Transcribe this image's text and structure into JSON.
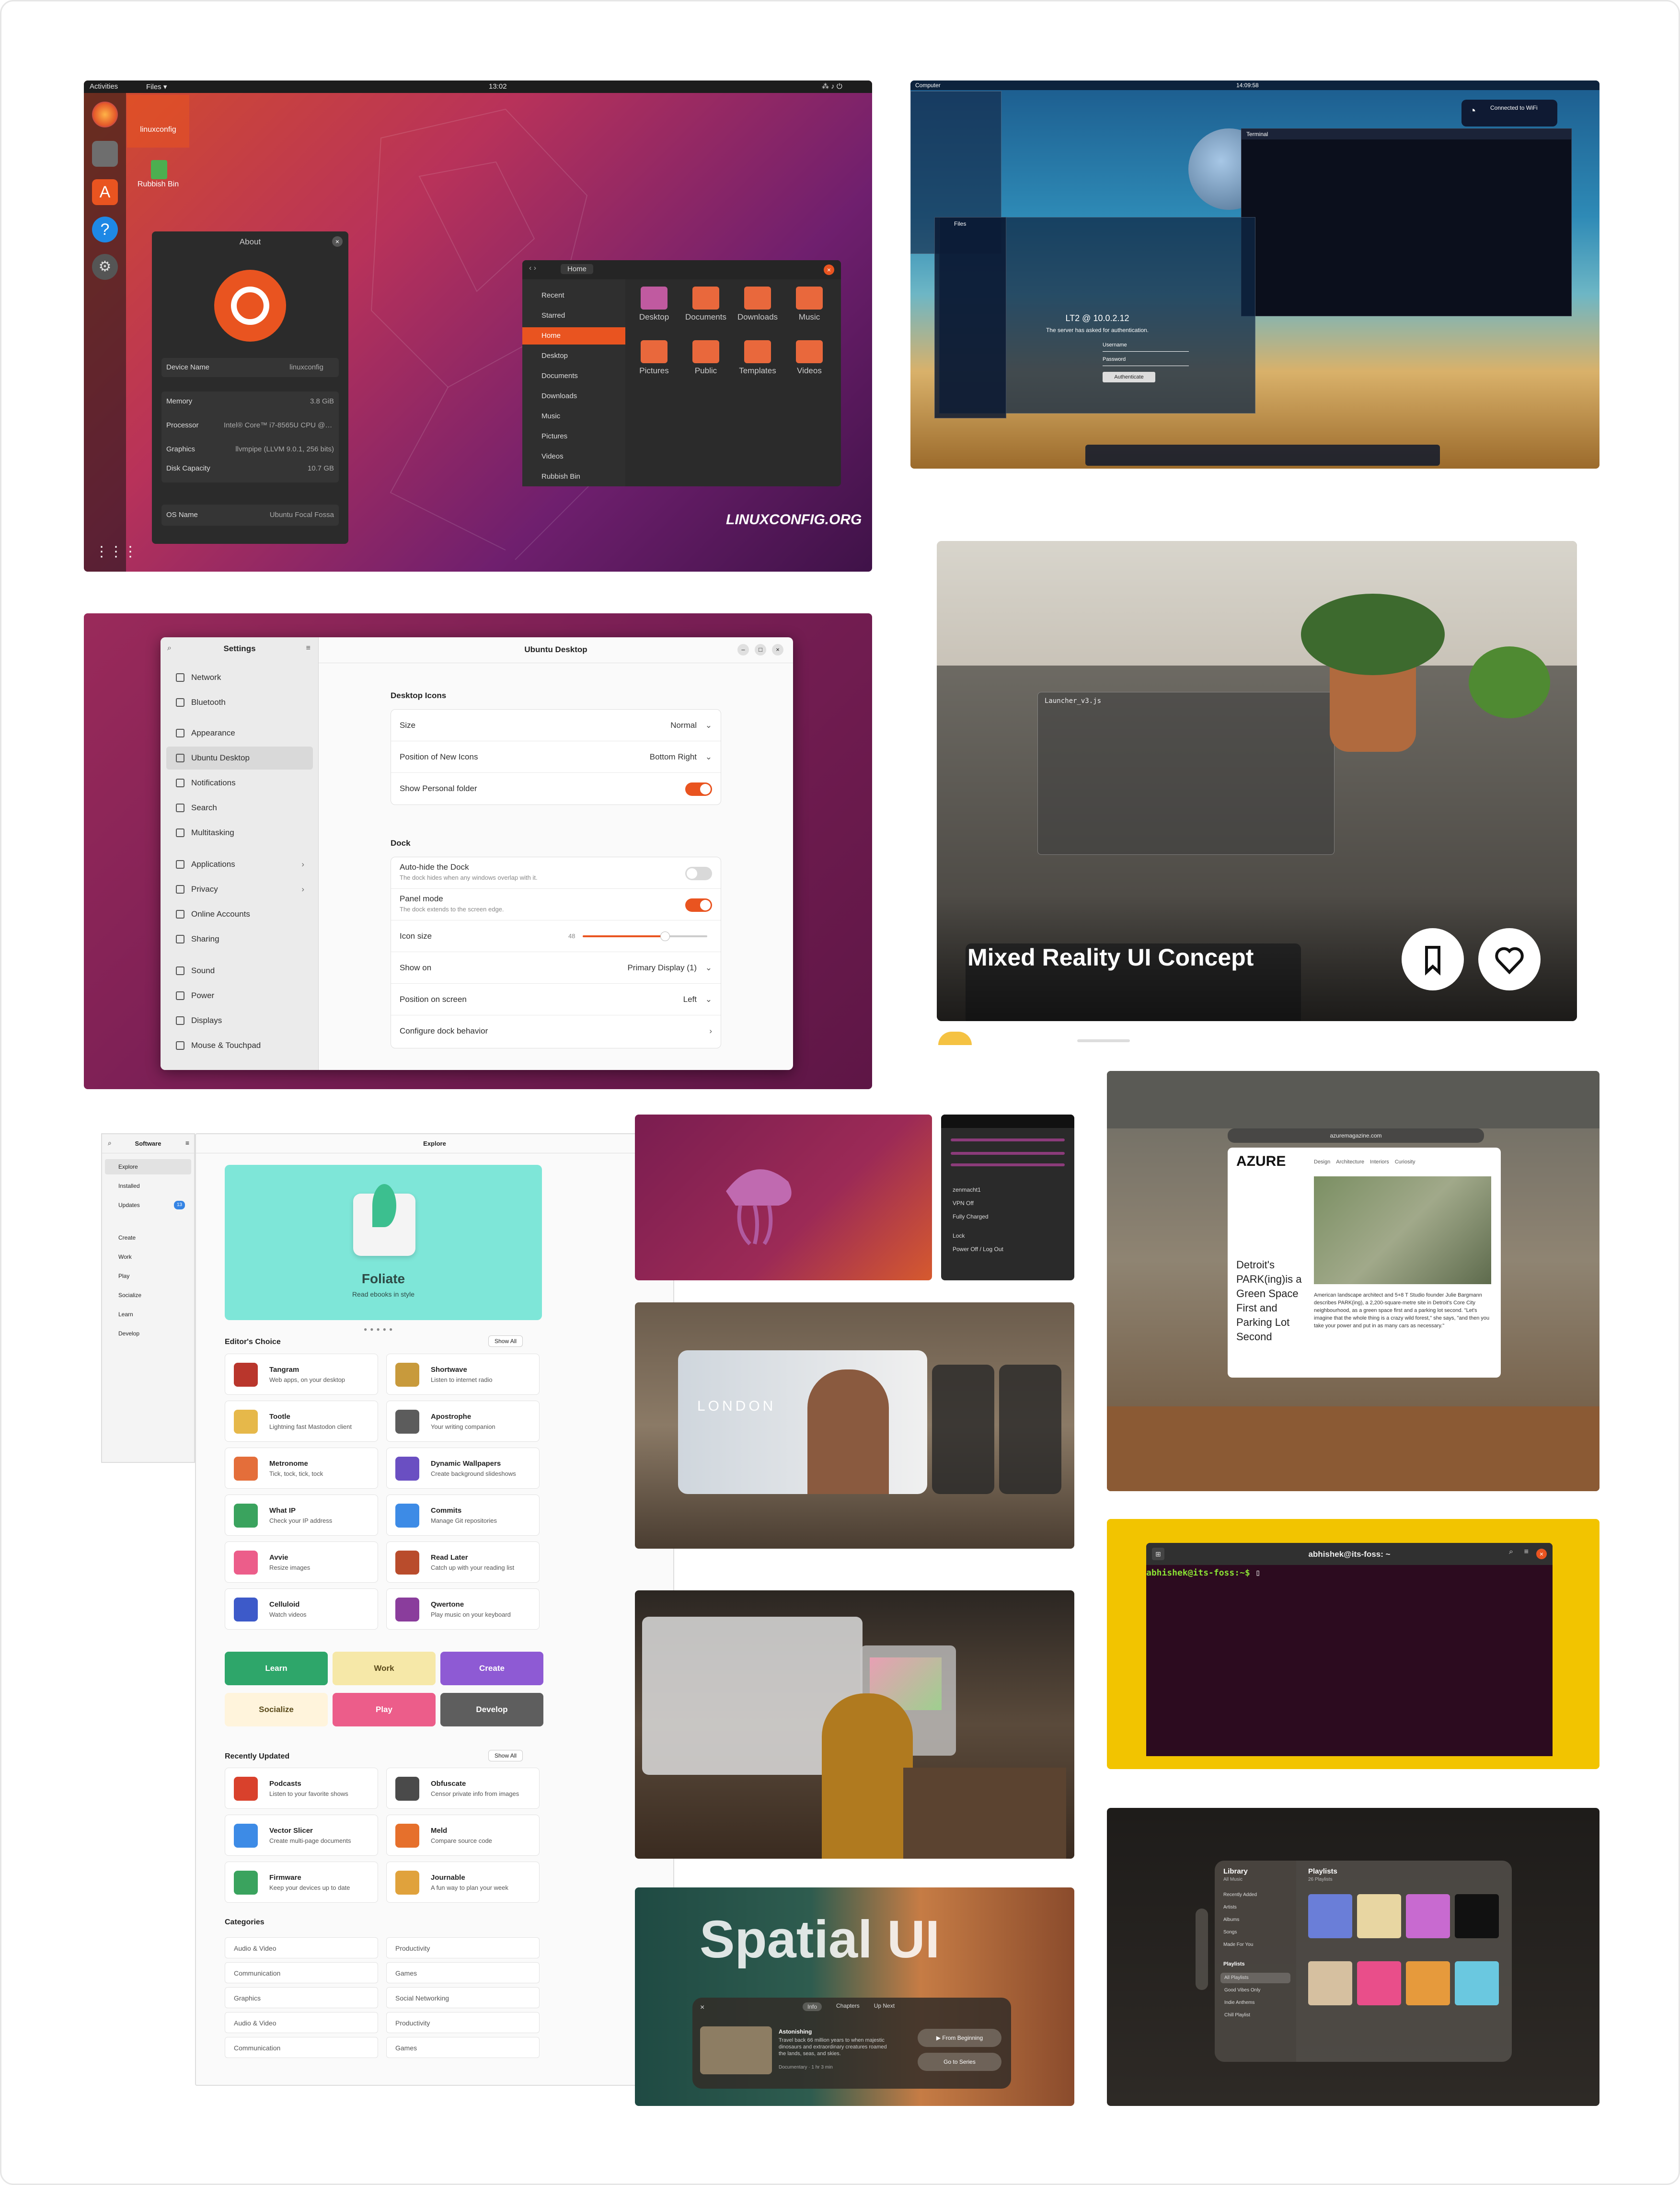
{
  "ubuntu_desktop": {
    "topbar": {
      "activities": "Activities",
      "app": "Files ▾",
      "clock": "13:02"
    },
    "desktop_icons": [
      "linuxconfig",
      "Rubbish Bin"
    ],
    "about": {
      "title": "About",
      "device_name_label": "Device Name",
      "device_name_value": "linuxconfig",
      "memory_label": "Memory",
      "memory_value": "3.8 GiB",
      "processor_label": "Processor",
      "processor_value": "Intel® Core™ i7-8565U CPU @ 1...",
      "graphics_label": "Graphics",
      "graphics_value": "llvmpipe (LLVM 9.0.1, 256 bits)",
      "disk_label": "Disk Capacity",
      "disk_value": "10.7 GB",
      "os_label": "OS Name",
      "os_value": "Ubuntu Focal Fossa"
    },
    "files": {
      "location": "Home",
      "sidebar": [
        "Recent",
        "Starred",
        "Home",
        "Desktop",
        "Documents",
        "Downloads",
        "Music",
        "Pictures",
        "Videos",
        "Rubbish Bin"
      ],
      "folders": [
        "Desktop",
        "Documents",
        "Downloads",
        "Music",
        "Pictures",
        "Public",
        "Templates",
        "Videos"
      ]
    },
    "watermark": "LINUXCONFIG.ORG",
    "brand": "LINUXCONFIG.ORG"
  },
  "win_desktop": {
    "start_title": "Computer",
    "clock": "14:09:58",
    "wifi_title": "Connected to WiFi",
    "terminal_title": "Terminal",
    "login_title": "LT2 @ 10.0.2.12",
    "login_sub": "The server has asked for authentication.",
    "login_user": "Username",
    "login_pass": "Password",
    "login_button": "Authenticate",
    "files_title": "Files"
  },
  "mixed_reality": {
    "title": "Mixed Reality UI Concept",
    "window_title": "Launcher_v3.js"
  },
  "settings": {
    "sidebar_title": "Settings",
    "main_title": "Ubuntu Desktop",
    "items": [
      "Network",
      "Bluetooth",
      "Appearance",
      "Ubuntu Desktop",
      "Notifications",
      "Search",
      "Multitasking",
      "Applications",
      "Privacy",
      "Online Accounts",
      "Sharing",
      "Sound",
      "Power",
      "Displays",
      "Mouse & Touchpad"
    ],
    "desktop_icons_heading": "Desktop Icons",
    "size_label": "Size",
    "size_value": "Normal",
    "position_label": "Position of New Icons",
    "position_value": "Bottom Right",
    "personal_folder_label": "Show Personal folder",
    "dock_heading": "Dock",
    "autohide_label": "Auto-hide the Dock",
    "autohide_sub": "The dock hides when any windows overlap with it.",
    "panel_label": "Panel mode",
    "panel_sub": "The dock extends to the screen edge.",
    "icon_size_label": "Icon size",
    "icon_size_value": "48",
    "show_on_label": "Show on",
    "show_on_value": "Primary Display (1)",
    "screen_pos_label": "Position on screen",
    "screen_pos_value": "Left",
    "configure_label": "Configure dock behavior"
  },
  "software": {
    "side_title": "Software",
    "side_items": [
      "Explore",
      "Installed",
      "Updates",
      "Create",
      "Work",
      "Play",
      "Socialize",
      "Learn",
      "Develop"
    ],
    "updates_badge": "13",
    "main_title": "Explore",
    "hero_title": "Foliate",
    "hero_sub": "Read ebooks in style",
    "editors_heading": "Editor's Choice",
    "show_all": "Show All",
    "editors": [
      {
        "name": "Tangram",
        "desc": "Web apps, on your desktop"
      },
      {
        "name": "Shortwave",
        "desc": "Listen to internet radio"
      },
      {
        "name": "Tootle",
        "desc": "Lightning fast Mastodon client"
      },
      {
        "name": "Apostrophe",
        "desc": "Your writing companion"
      },
      {
        "name": "Metronome",
        "desc": "Tick, tock, tick, tock"
      },
      {
        "name": "Dynamic Wallpapers",
        "desc": "Create background slideshows"
      },
      {
        "name": "What IP",
        "desc": "Check your IP address"
      },
      {
        "name": "Commits",
        "desc": "Manage Git repositories"
      },
      {
        "name": "Avvie",
        "desc": "Resize images"
      },
      {
        "name": "Read Later",
        "desc": "Catch up with your reading list"
      },
      {
        "name": "Celluloid",
        "desc": "Watch videos"
      },
      {
        "name": "Qwertone",
        "desc": "Play music on your keyboard"
      }
    ],
    "categories_buttons": [
      "Learn",
      "Work",
      "Create",
      "Socialize",
      "Play",
      "Develop"
    ],
    "recent_heading": "Recently Updated",
    "recent": [
      {
        "name": "Podcasts",
        "desc": "Listen to your favorite shows"
      },
      {
        "name": "Obfuscate",
        "desc": "Censor private info from images"
      },
      {
        "name": "Vector Slicer",
        "desc": "Create multi-page documents"
      },
      {
        "name": "Meld",
        "desc": "Compare source code"
      },
      {
        "name": "Firmware",
        "desc": "Keep your devices up to date"
      },
      {
        "name": "Journable",
        "desc": "A fun way to plan your week"
      }
    ],
    "categories_heading": "Categories",
    "categories": [
      "Audio & Video",
      "Productivity",
      "Communication",
      "Games",
      "Graphics",
      "Social Networking",
      "Audio & Video",
      "Productivity",
      "Communication",
      "Games"
    ]
  },
  "quick_menu": {
    "items": [
      "zenmacht1",
      "VPN Off",
      "Fully Charged",
      "Lock",
      "Power Off / Log Out"
    ]
  },
  "vision_media": {
    "city": "LONDON"
  },
  "azure": {
    "brand": "AZURE",
    "nav": [
      "Design",
      "Architecture",
      "Interiors",
      "Curiosity"
    ],
    "url": "azuremagazine.com",
    "headline": "Detroit's PARK(ing)is a Green Space First and Parking Lot Second",
    "body": "American landscape architect and 5+8 T Studio founder Julie Bargmann describes PARK(ing), a 2,200-square-metre site in Detroit's Core City neighbourhood, as a green space first and a parking lot second. \"Let's imagine that the whole thing is a crazy wild forest,\" she says, \"and then you take your power and put in as many cars as necessary.\""
  },
  "terminal": {
    "title": "abhishek@its-foss: ~",
    "prompt": "abhishek@its-foss:~$"
  },
  "spatial": {
    "title": "Spatial UI",
    "tabs": [
      "Info",
      "Chapters",
      "Up Next"
    ],
    "episode_title": "Astonishing",
    "episode_desc": "Travel back 66 million years to when majestic dinosaurs and extraordinary creatures roamed the lands, seas, and skies.",
    "episode_meta": "Documentary · 1 hr 3 min",
    "btn_begin": "▶ From Beginning",
    "btn_series": "Go to Series"
  },
  "music": {
    "library_title": "Library",
    "library_sub": "All Music",
    "library_items": [
      "Recently Added",
      "Artists",
      "Albums",
      "Songs",
      "Made For You"
    ],
    "playlists_heading": "Playlists",
    "playlist_items": [
      "All Playlists",
      "Good Vibes Only",
      "Indie Anthems",
      "Chill Playlist"
    ],
    "playlists_title": "Playlists",
    "playlists_sub": "26 Playlists"
  },
  "colors": {
    "ubuntu_orange": "#e95420",
    "foliate_bg": "#7ee6d8",
    "learn_green": "#2ea66a",
    "create_purple": "#8e5ad4",
    "play_pink": "#ec5d8a",
    "develop_gray": "#5e5e5e",
    "work_yellow": "#f6e8a8",
    "socialize": "#fff4dc"
  }
}
